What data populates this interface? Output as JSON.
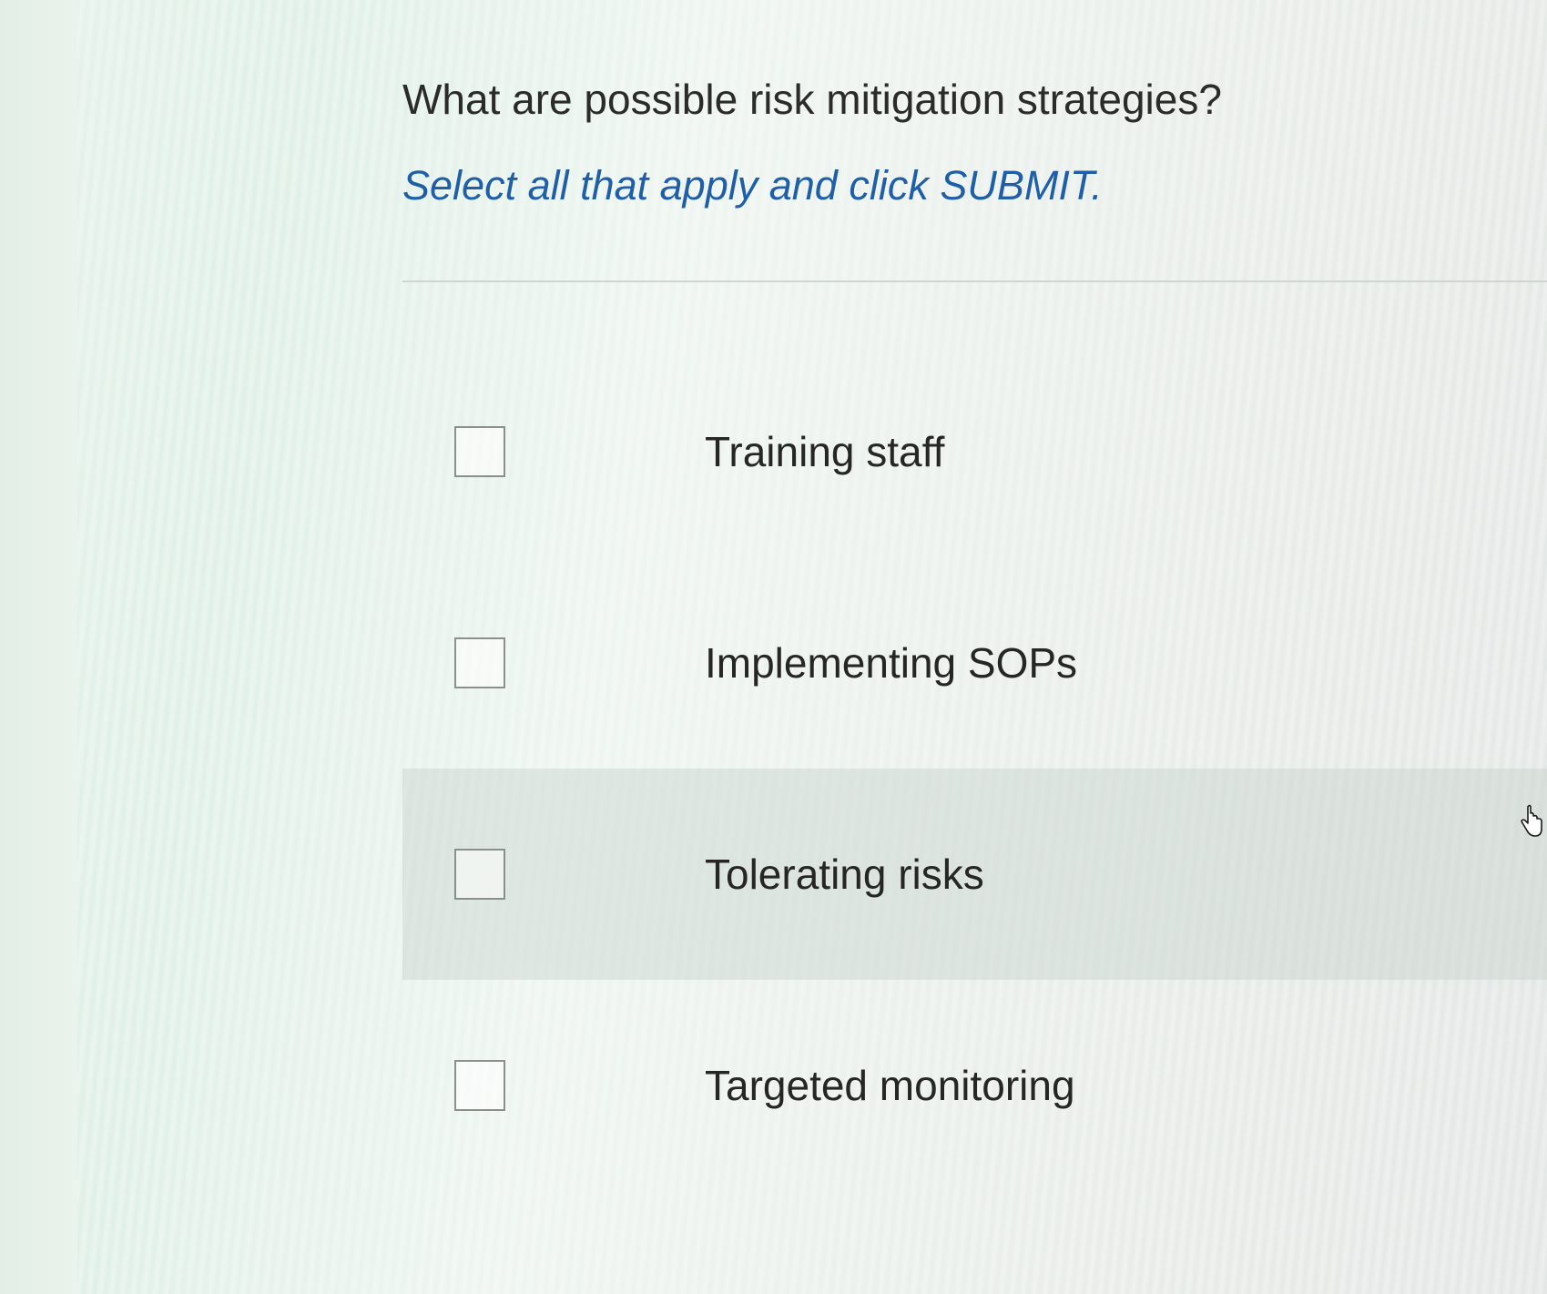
{
  "question": {
    "title": "What are possible risk mitigation strategies?",
    "instruction": "Select all that apply and click SUBMIT."
  },
  "options": [
    {
      "label": "Training staff",
      "checked": false
    },
    {
      "label": "Implementing SOPs",
      "checked": false
    },
    {
      "label": "Tolerating risks",
      "checked": false,
      "hovered": true
    },
    {
      "label": "Targeted monitoring",
      "checked": false
    }
  ],
  "cursor": {
    "icon": "hand-pointer-icon"
  },
  "colors": {
    "instruction_text": "#1f5fa8",
    "question_text": "#2b2b2b",
    "checkbox_border": "#8d8f8e"
  }
}
